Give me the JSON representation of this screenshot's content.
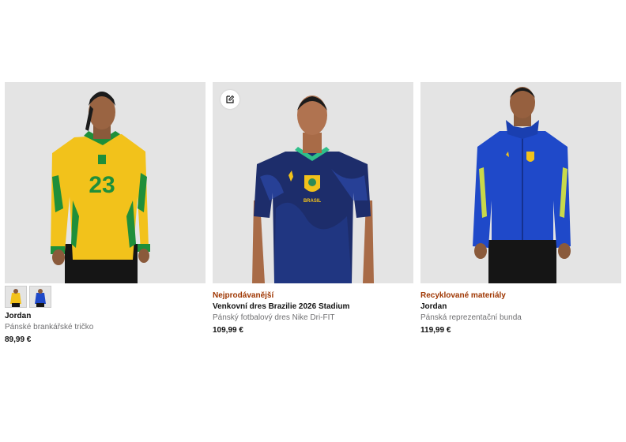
{
  "products": [
    {
      "badge": "",
      "title": "Jordan",
      "subtitle": "Pánské brankářské tričko",
      "price": "89,99 €",
      "jersey_number": "23",
      "colors": {
        "primary": "#f2c21b",
        "accent": "#1f8f3a"
      }
    },
    {
      "badge": "Nejprodávanější",
      "title": "Venkovní dres Brazilie 2026 Stadium",
      "subtitle": "Pánský fotbalový dres Nike Dri-FIT",
      "price": "109,99 €",
      "crest_text": "BRASIL",
      "colors": {
        "primary": "#1d2d6b",
        "accent": "#2e4db3"
      }
    },
    {
      "badge": "Recyklované materiály",
      "title": "Jordan",
      "subtitle": "Pánská reprezentační bunda",
      "price": "119,99 €",
      "colors": {
        "primary": "#1f49c9",
        "accent": "#c9d94a"
      }
    }
  ],
  "colors": {
    "badge": "#9e3500",
    "photo_bg": "#e5e5e5",
    "subtitle": "#707072"
  }
}
